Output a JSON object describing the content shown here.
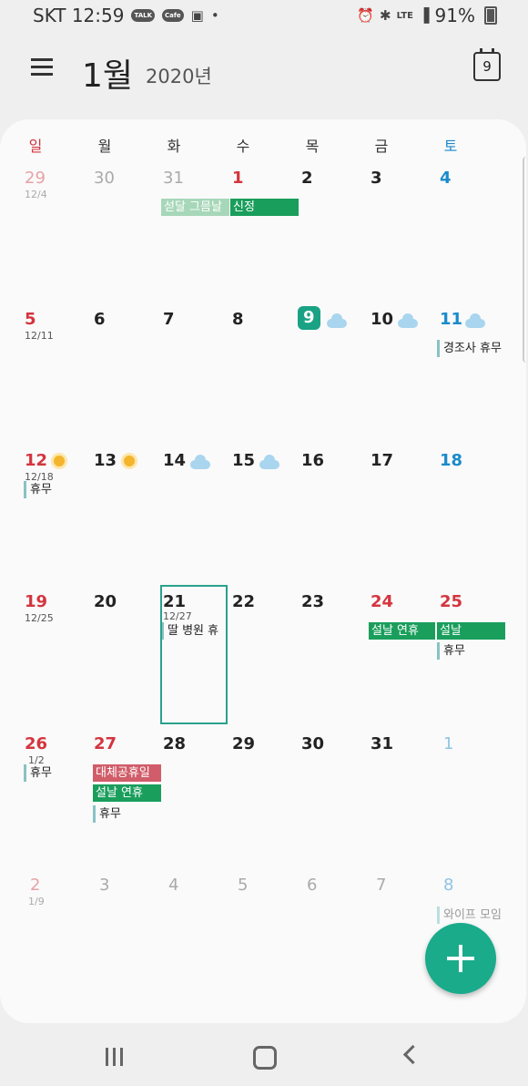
{
  "status_bar": {
    "carrier_time": "SKT 12:59",
    "notif_icons": [
      "talk-icon",
      "cafe-icon",
      "voicemail-icon"
    ],
    "talk_label": "TALK",
    "cafe_label": "Cafe",
    "dot": "•",
    "lte_label": "LTE",
    "battery_text": "91%"
  },
  "header": {
    "month": "1월",
    "year": "2020년",
    "today_number": "9"
  },
  "days_of_week": [
    "일",
    "월",
    "화",
    "수",
    "목",
    "금",
    "토"
  ],
  "weeks": [
    {
      "days": [
        {
          "num": "29",
          "lunar": "12/4",
          "other": true
        },
        {
          "num": "30",
          "other": true
        },
        {
          "num": "31",
          "other": true
        },
        {
          "num": "1"
        },
        {
          "num": "2"
        },
        {
          "num": "3"
        },
        {
          "num": "4"
        }
      ],
      "events": [
        {
          "label": "섣달 그믐날",
          "style": "lightgreen"
        },
        {
          "label": "신정",
          "style": "green"
        }
      ]
    },
    {
      "days": [
        {
          "num": "5",
          "lunar": "12/11"
        },
        {
          "num": "6"
        },
        {
          "num": "7"
        },
        {
          "num": "8"
        },
        {
          "num": "9",
          "today": true,
          "weather": "cloud"
        },
        {
          "num": "10",
          "weather": "cloud"
        },
        {
          "num": "11",
          "weather": "cloud"
        }
      ],
      "events": [
        {
          "label": "경조사 휴무",
          "style": "plain"
        }
      ]
    },
    {
      "days": [
        {
          "num": "12",
          "lunar": "12/18",
          "weather": "sun"
        },
        {
          "num": "13",
          "weather": "sun"
        },
        {
          "num": "14",
          "weather": "cloud"
        },
        {
          "num": "15",
          "weather": "cloud"
        },
        {
          "num": "16"
        },
        {
          "num": "17"
        },
        {
          "num": "18"
        }
      ],
      "events": [
        {
          "label": "휴무",
          "style": "plain"
        }
      ]
    },
    {
      "days": [
        {
          "num": "19",
          "lunar": "12/25"
        },
        {
          "num": "20"
        },
        {
          "num": "21",
          "lunar": "12/27",
          "selected": true
        },
        {
          "num": "22"
        },
        {
          "num": "23"
        },
        {
          "num": "24",
          "holiday": true
        },
        {
          "num": "25",
          "holiday": true
        }
      ],
      "events": [
        {
          "label": "딸 병원  휴",
          "style": "plain"
        },
        {
          "label": "설날 연휴",
          "style": "green"
        },
        {
          "label": "설날",
          "style": "green"
        },
        {
          "label": "휴무",
          "style": "plain"
        }
      ]
    },
    {
      "days": [
        {
          "num": "26",
          "lunar": "1/2",
          "holiday": true
        },
        {
          "num": "27",
          "holiday": true
        },
        {
          "num": "28"
        },
        {
          "num": "29"
        },
        {
          "num": "30"
        },
        {
          "num": "31"
        },
        {
          "num": "1",
          "other": true
        }
      ],
      "events": [
        {
          "label": "휴무",
          "style": "plain"
        },
        {
          "label": "대체공휴일",
          "style": "red"
        },
        {
          "label": "설날 연휴",
          "style": "green"
        },
        {
          "label": "휴무",
          "style": "plain"
        }
      ]
    },
    {
      "days": [
        {
          "num": "2",
          "lunar": "1/9",
          "other": true
        },
        {
          "num": "3",
          "other": true
        },
        {
          "num": "4",
          "other": true
        },
        {
          "num": "5",
          "other": true
        },
        {
          "num": "6",
          "other": true
        },
        {
          "num": "7",
          "other": true
        },
        {
          "num": "8",
          "other": true
        }
      ],
      "events": [
        {
          "label": "와이프 모임",
          "style": "plain"
        }
      ]
    }
  ],
  "colors": {
    "accent": "#1aab8b",
    "sunday": "#d4353f",
    "saturday": "#1b8acb",
    "event_green": "#1a9e5c",
    "event_red": "#d15d6a"
  },
  "fab_icon": "plus-icon",
  "nav": {
    "recent_icon": "recent-apps-icon",
    "home_icon": "home-icon",
    "back_icon": "back-icon"
  }
}
